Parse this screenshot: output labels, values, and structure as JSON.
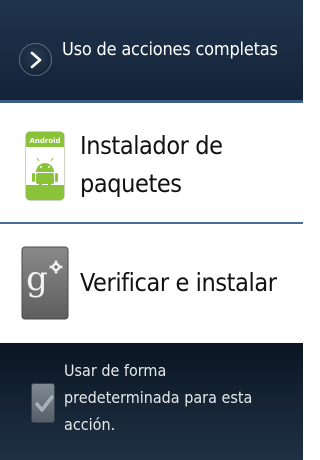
{
  "header": {
    "title": "Uso de acciones completas",
    "icon": "chevron-right-icon"
  },
  "options": [
    {
      "label": "Instalador de paquetes",
      "icon": "android-package-installer-icon",
      "icon_text": "Android"
    },
    {
      "label": "Verificar e instalar",
      "icon": "google-settings-icon",
      "icon_text": "g"
    }
  ],
  "footer": {
    "checkbox_label": "Usar de forma predeterminada para esta acción.",
    "checkbox_checked": true
  },
  "colors": {
    "header_bg": "#1b2c42",
    "divider": "#4b6e95",
    "footer_bg": "#16253a",
    "package_green": "#8ac23a"
  }
}
